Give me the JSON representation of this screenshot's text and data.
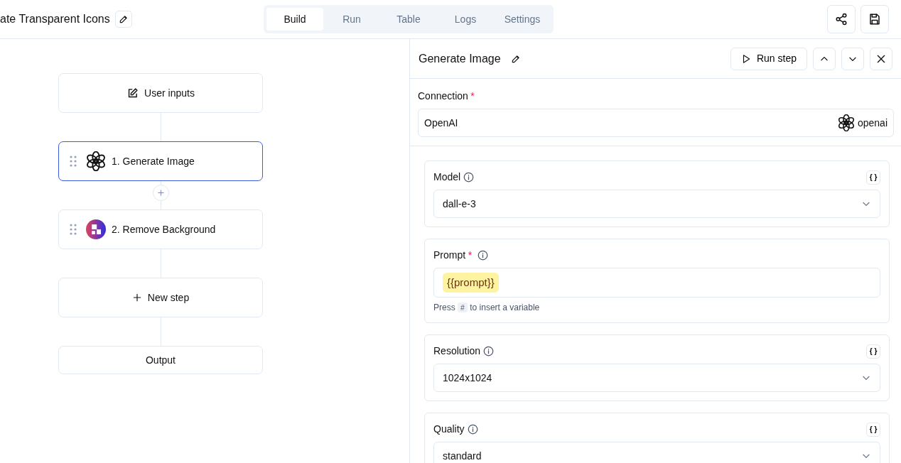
{
  "header": {
    "title": "ate Transparent Icons",
    "tabs": [
      {
        "label": "Build",
        "selected": true
      },
      {
        "label": "Run",
        "selected": false
      },
      {
        "label": "Table",
        "selected": false
      },
      {
        "label": "Logs",
        "selected": false
      },
      {
        "label": "Settings",
        "selected": false
      }
    ]
  },
  "flow": {
    "nodes": [
      {
        "kind": "inputs",
        "label": "User inputs",
        "selected": false
      },
      {
        "kind": "openai",
        "label": "1. Generate Image",
        "selected": true
      },
      {
        "kind": "removebg",
        "label": "2. Remove Background",
        "selected": false
      },
      {
        "kind": "new",
        "label": "New step",
        "selected": false
      },
      {
        "kind": "output",
        "label": "Output",
        "selected": false
      }
    ]
  },
  "panel": {
    "title": "Generate Image",
    "run_button": "Run step",
    "connection": {
      "label": "Connection",
      "required_mark": "*",
      "value": "OpenAI",
      "provider": "openai"
    },
    "fields": [
      {
        "kind": "select",
        "label": "Model",
        "toggle": "{ }",
        "value": "dall-e-3"
      },
      {
        "kind": "text",
        "label": "Prompt",
        "required_mark": "*",
        "variable": "{{prompt}}",
        "hint_before": "Press",
        "hint_key": "#",
        "hint_after": "to insert a variable"
      },
      {
        "kind": "select",
        "label": "Resolution",
        "toggle": "{ }",
        "value": "1024x1024"
      },
      {
        "kind": "select",
        "label": "Quality",
        "toggle": "{ }",
        "value": "standard"
      }
    ]
  }
}
